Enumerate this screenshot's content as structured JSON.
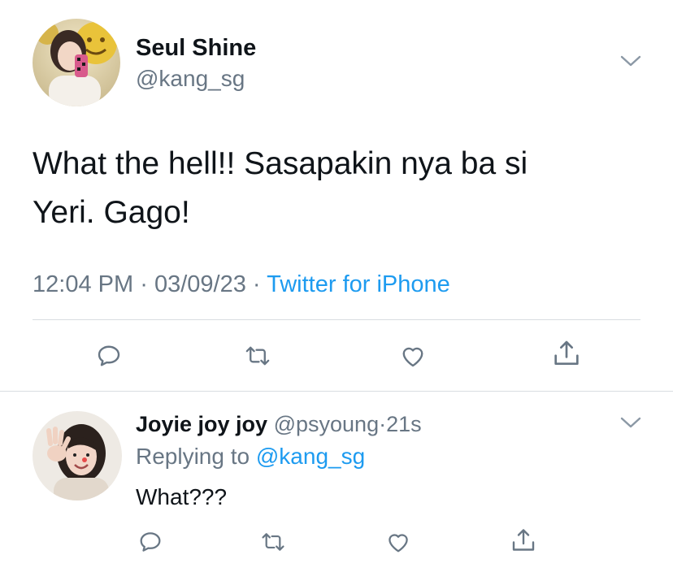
{
  "main_tweet": {
    "author_name": "Seul Shine",
    "author_handle": "@kang_sg",
    "text_line1": "What the hell!! Sasapakin nya ba si",
    "text_line2": "Yeri. Gago!",
    "time": "12:04 PM",
    "date": "03/09/23",
    "separator": "·",
    "source": "Twitter for iPhone",
    "actions": [
      "reply-icon",
      "retweet-icon",
      "like-icon",
      "share-icon"
    ]
  },
  "reply_tweet": {
    "author_name": "Joyie joy joy",
    "author_handle": "@psyoung",
    "separator": "·",
    "age": "21s",
    "replying_prefix": "Replying to",
    "replying_handle": "@kang_sg",
    "text": "What???",
    "actions": [
      "reply-icon",
      "retweet-icon",
      "like-icon",
      "share-icon"
    ]
  },
  "colors": {
    "text": "#0f1419",
    "secondary": "#687684",
    "link": "#1d9bf0",
    "divider": "#d9dde1"
  }
}
